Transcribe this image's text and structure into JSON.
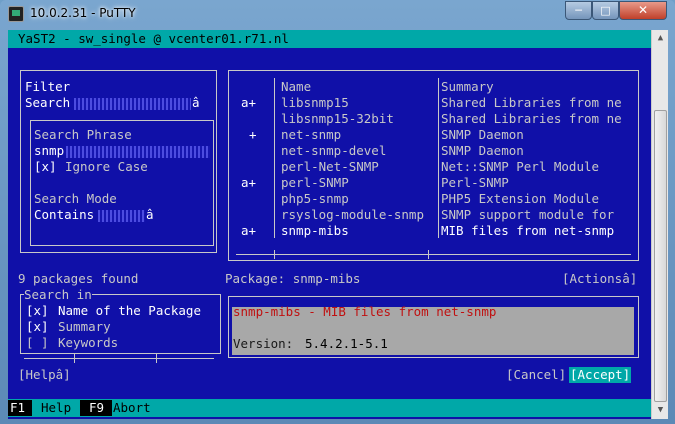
{
  "window": {
    "title": "10.0.2.31 - PuTTY",
    "min_label": "─",
    "max_label": "□",
    "close_label": "✕"
  },
  "header": {
    "title": "YaST2 - sw_single @ vcenter01.r71.nl"
  },
  "filter": {
    "label": "Filter",
    "value": "Search",
    "dropdown_arrow": "â",
    "search_phrase_label": "Search Phrase",
    "search_phrase_value": "snmp",
    "ignore_case_box": "[x]",
    "ignore_case_label": "Ignore Case",
    "search_mode_label": "Search Mode",
    "search_mode_value": "Contains",
    "search_mode_arrow": "â"
  },
  "packages": {
    "columns": [
      "Name",
      "Summary"
    ],
    "rows": [
      {
        "status": "a+",
        "name": "libsnmp15",
        "summary": "Shared Libraries from ne"
      },
      {
        "status": "",
        "name": "libsnmp15-32bit",
        "summary": "Shared Libraries from ne"
      },
      {
        "status": "+",
        "name": "net-snmp",
        "summary": "SNMP Daemon"
      },
      {
        "status": "",
        "name": "net-snmp-devel",
        "summary": "SNMP Daemon"
      },
      {
        "status": "",
        "name": "perl-Net-SNMP",
        "summary": "Net::SNMP Perl Module"
      },
      {
        "status": "a+",
        "name": "perl-SNMP",
        "summary": "Perl-SNMP"
      },
      {
        "status": "",
        "name": "php5-snmp",
        "summary": "PHP5 Extension Module"
      },
      {
        "status": "",
        "name": "rsyslog-module-snmp",
        "summary": "SNMP support module for"
      },
      {
        "status": "a+",
        "name": "snmp-mibs",
        "summary": "MIB files from net-snmp"
      }
    ]
  },
  "status": {
    "count": "9 packages found",
    "package": "Package: snmp-mibs",
    "actions": "[Actionsâ]"
  },
  "search_in": {
    "label": "Search in",
    "options": [
      {
        "box": "[x]",
        "label": "Name of the Package"
      },
      {
        "box": "[x]",
        "label": "Summary"
      },
      {
        "box": "[ ]",
        "label": "Keywords"
      }
    ]
  },
  "details": {
    "headline": "snmp-mibs - MIB files from net-snmp",
    "version_label": "Version:",
    "version_value": "5.4.2.1-5.1"
  },
  "buttons": {
    "help": "[Helpâ]",
    "cancel": "[Cancel]",
    "accept": "[Accept]"
  },
  "footer": {
    "f1_key": "F1",
    "f1_label": "Help",
    "f9_key": "F9",
    "f9_label": "Abort"
  },
  "colors": {
    "terminal_bg": "#1010a8",
    "cyan": "#00a8a8",
    "detail_bg": "#a8a8a8",
    "headline_red": "#c01010"
  }
}
